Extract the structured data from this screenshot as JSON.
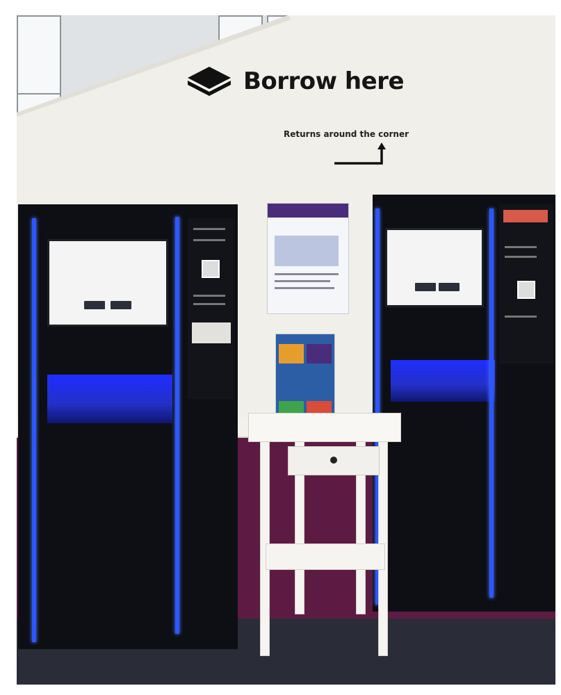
{
  "sign": {
    "title": "Borrow here",
    "icon": "book-icon"
  },
  "returns": {
    "text": "Returns around the corner",
    "icon": "corner-arrow-icon"
  },
  "colors": {
    "purple_wall": "#5d1b44",
    "kiosk_led": "#2d56ff",
    "kiosk_body": "#0d0f14"
  }
}
